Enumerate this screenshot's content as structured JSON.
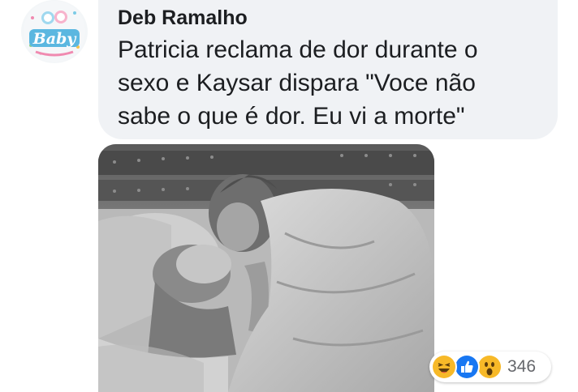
{
  "avatar": {
    "logo_text": "Baby",
    "icon": "baby-page-logo"
  },
  "comment": {
    "author": "Deb Ramalho",
    "text_lines": [
      "Patricia reclama de dor durante o",
      "sexo e Kaysar dispara \"Voce não",
      "sabe o que é dor. Eu vi a morte\""
    ]
  },
  "photo": {
    "description_icon": "attached-photo"
  },
  "reactions": {
    "icons": [
      "haha-icon",
      "like-icon",
      "wow-icon"
    ],
    "count": "346"
  },
  "colors": {
    "bubble": "#f0f2f5",
    "text": "#1c1e21",
    "like_blue": "#1877f2",
    "haha_yellow": "#f7b928",
    "count_gray": "#65676b"
  }
}
